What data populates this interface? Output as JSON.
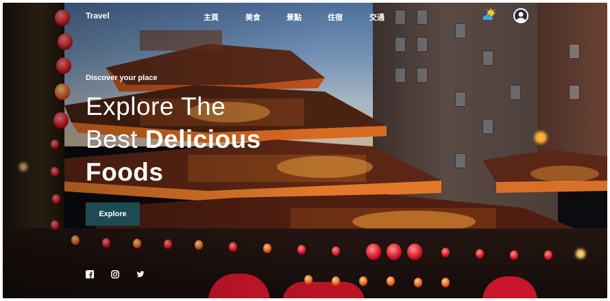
{
  "header": {
    "brand": "Travel",
    "nav": [
      {
        "label": "主頁",
        "name": "nav-home"
      },
      {
        "label": "美食",
        "name": "nav-food"
      },
      {
        "label": "景點",
        "name": "nav-attractions"
      },
      {
        "label": "住宿",
        "name": "nav-lodging"
      },
      {
        "label": "交通",
        "name": "nav-transport"
      }
    ],
    "weather_icon": "partly-cloudy-icon",
    "avatar_icon": "user-avatar-icon"
  },
  "hero": {
    "eyebrow": "Discover your place",
    "headline_line1": "Explore The",
    "headline_line2_light": "Best ",
    "headline_line2_bold": "Delicious",
    "headline_line3_bold": "Foods",
    "cta_label": "Explore",
    "cta_color": "#1d4a53"
  },
  "social": [
    "facebook-icon",
    "instagram-icon",
    "twitter-icon"
  ],
  "colors": {
    "accent_lantern": "#d0121f",
    "sky": "#6f8fb3"
  }
}
